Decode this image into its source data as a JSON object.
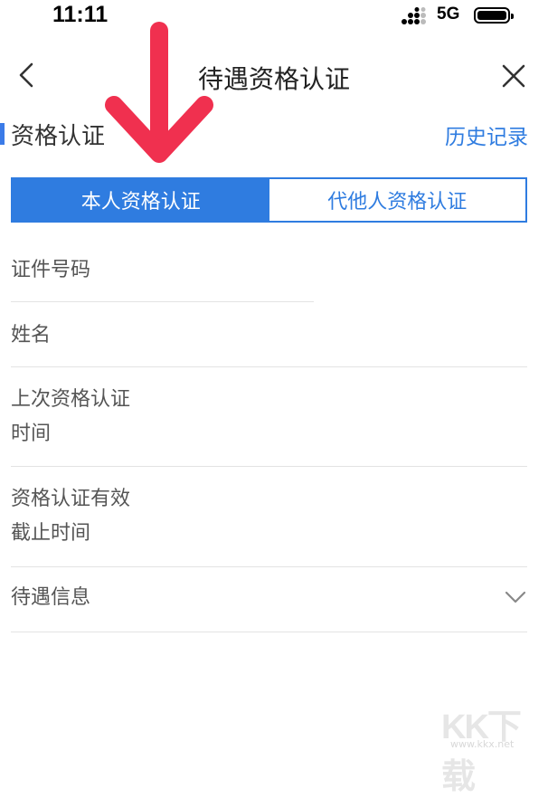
{
  "status_bar": {
    "time": "11:11",
    "network": "5G"
  },
  "nav": {
    "title": "待遇资格认证"
  },
  "section": {
    "title": "资格认证",
    "history_link": "历史记录"
  },
  "tabs": [
    {
      "label": "本人资格认证",
      "active": true
    },
    {
      "label": "代他人资格认证",
      "active": false
    }
  ],
  "form": {
    "id_number_label": "证件号码",
    "name_label": "姓名",
    "last_cert_time_label_line1": "上次资格认证",
    "last_cert_time_label_line2": "时间",
    "valid_until_label_line1": "资格认证有效",
    "valid_until_label_line2": "截止时间",
    "benefit_info_label": "待遇信息"
  },
  "colors": {
    "accent": "#2f7ce0",
    "annotation_arrow": "#f0304f"
  },
  "icons": [
    "back-icon",
    "close-icon",
    "chevron-down-icon",
    "signal-icon",
    "battery-icon",
    "arrow-down-annotation-icon"
  ],
  "watermark": {
    "logo": "KK下载",
    "url": "www.kkx.net"
  }
}
